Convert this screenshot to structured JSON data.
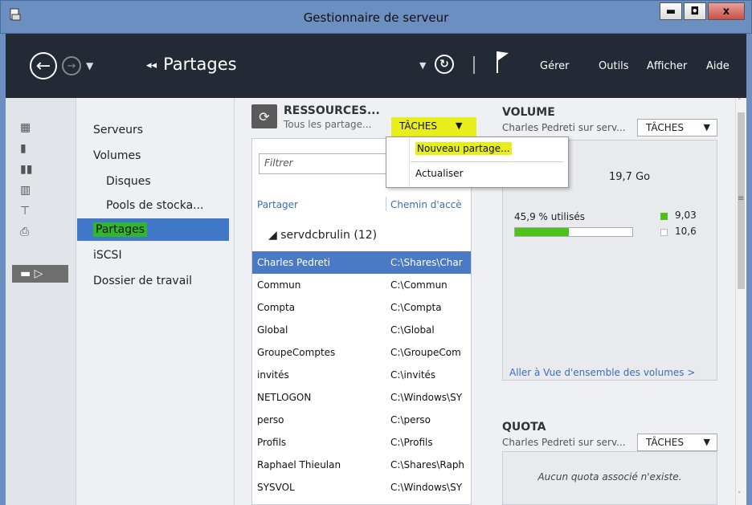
{
  "window": {
    "title": "Gestionnaire de serveur",
    "minimize": "▬",
    "maximize": "◘",
    "close": "x"
  },
  "toolbar": {
    "breadcrumb_arrows": "◂◂",
    "breadcrumb": "Partages",
    "menus": [
      "Gérer",
      "Outils",
      "Afficher",
      "Aide"
    ]
  },
  "nav": {
    "items": [
      {
        "label": "Serveurs"
      },
      {
        "label": "Volumes"
      },
      {
        "label": "Disques"
      },
      {
        "label": "Pools de stocka..."
      },
      {
        "label": "Partages"
      },
      {
        "label": "iSCSI"
      },
      {
        "label": "Dossier de travail"
      }
    ]
  },
  "shares": {
    "title": "RESSOURCES...",
    "subtitle": "Tous les partage...",
    "tasks": "TÂCHES",
    "filter_placeholder": "Filtrer",
    "col_share": "Partager",
    "col_path": "Chemin d'accè",
    "group": "servdcbrulin (12)",
    "rows": [
      {
        "name": "Charles Pedreti",
        "path": "C:\\Shares\\Char"
      },
      {
        "name": "Commun",
        "path": "C:\\Commun"
      },
      {
        "name": "Compta",
        "path": "C:\\Compta"
      },
      {
        "name": "Global",
        "path": "C:\\Global"
      },
      {
        "name": "GroupeComptes",
        "path": "C:\\GroupeCom"
      },
      {
        "name": "invités",
        "path": "C:\\invités"
      },
      {
        "name": "NETLOGON",
        "path": "C:\\Windows\\SY"
      },
      {
        "name": "perso",
        "path": "C:\\perso"
      },
      {
        "name": "Profils",
        "path": "C:\\Profils"
      },
      {
        "name": "Raphael Thieulan",
        "path": "C:\\Shares\\Raph"
      },
      {
        "name": "SYSVOL",
        "path": "C:\\Windows\\SY"
      }
    ]
  },
  "dropdown": {
    "new_share": "Nouveau partage...",
    "refresh": "Actualiser"
  },
  "volume": {
    "title": "VOLUME",
    "subtitle": "Charles Pedreti sur serv...",
    "tasks": "TÂCHES",
    "capacity": "19,7 Go",
    "used_label": "45,9 % utilisés",
    "used_fraction": 0.459,
    "used_value": "9,03",
    "free_value": "10,6",
    "link": "Aller à Vue d'ensemble des volumes >",
    "used_color": "#4cc21a"
  },
  "quota": {
    "title": "QUOTA",
    "subtitle": "Charles Pedreti sur serv...",
    "tasks": "TÂCHES",
    "empty": "Aucun quota associé n'existe."
  },
  "colors": {
    "highlight": "#e8ee1a",
    "selection": "#4a79c6"
  }
}
